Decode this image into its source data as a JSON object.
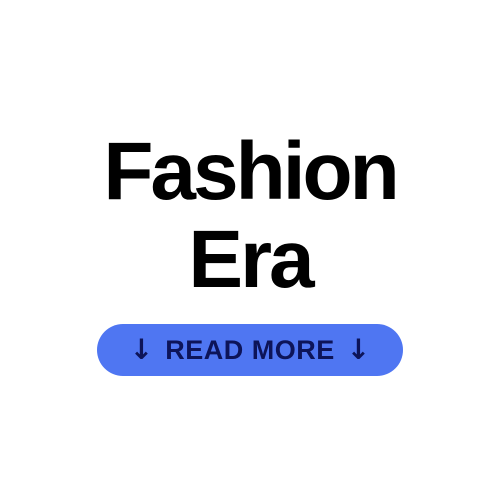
{
  "headline": {
    "line1": "Fashion",
    "line2": "Era"
  },
  "cta": {
    "label": "READ MORE",
    "icon_left": "arrow-down-icon",
    "icon_right": "arrow-down-icon",
    "background": "#4f76f2",
    "text_color": "#0d1459"
  }
}
